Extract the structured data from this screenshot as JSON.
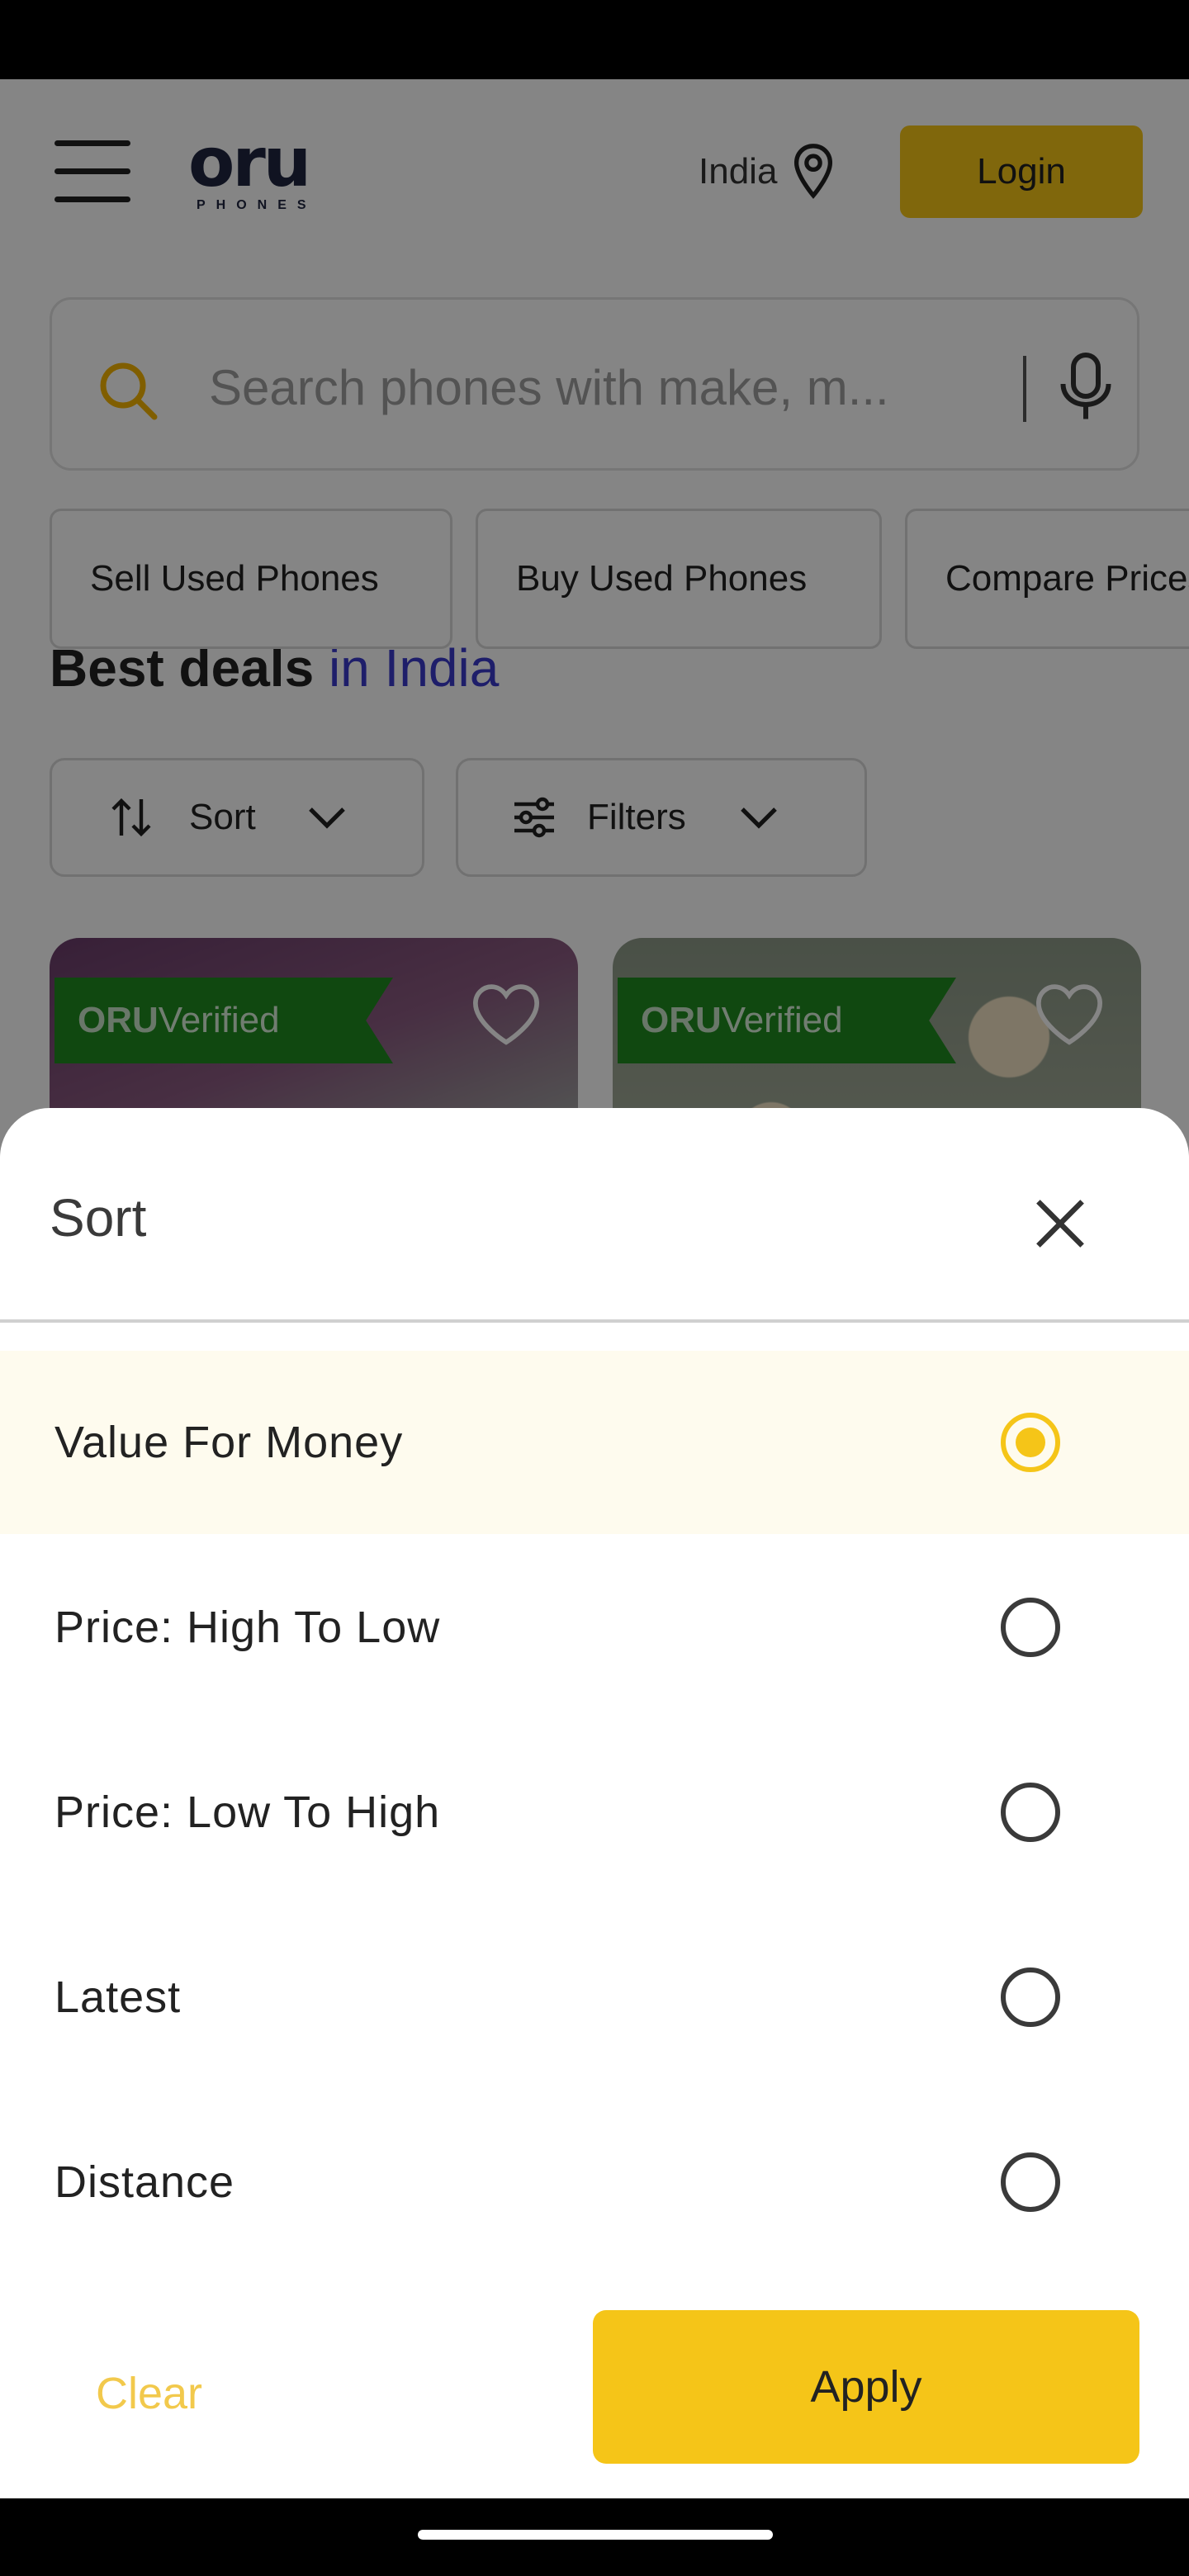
{
  "header": {
    "logo_text": "oru",
    "logo_sub": "PHONES",
    "location": "India",
    "login_label": "Login"
  },
  "search": {
    "placeholder": "Search phones with make, m..."
  },
  "quick_links": [
    "Sell Used Phones",
    "Buy Used Phones",
    "Compare Prices"
  ],
  "deals": {
    "heading": "Best deals",
    "heading_accent": "in India"
  },
  "controls": {
    "sort_label": "Sort",
    "filters_label": "Filters"
  },
  "cards": [
    {
      "badge_prefix": "ORU",
      "badge_suffix": "Verified"
    },
    {
      "badge_prefix": "ORU",
      "badge_suffix": "Verified"
    }
  ],
  "sort_sheet": {
    "title": "Sort",
    "options": [
      {
        "label": "Value For Money",
        "selected": true
      },
      {
        "label": "Price: High To Low",
        "selected": false
      },
      {
        "label": "Price: Low To High",
        "selected": false
      },
      {
        "label": "Latest",
        "selected": false
      },
      {
        "label": "Distance",
        "selected": false
      }
    ],
    "clear_label": "Clear",
    "apply_label": "Apply"
  },
  "colors": {
    "accent": "#f5c518",
    "verified_green": "#1f8a1f",
    "selected_row_bg": "#fefbee"
  }
}
